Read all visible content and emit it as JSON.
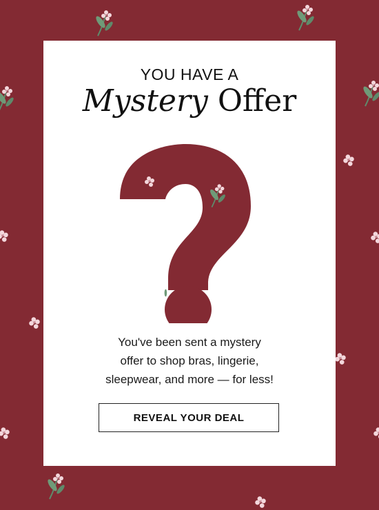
{
  "headline": {
    "line1": "YOU HAVE A",
    "italic_word": "Mystery",
    "regular_word": "Offer"
  },
  "graphic": {
    "icon": "question-mark-icon",
    "glyph": "?",
    "color": "#832a33"
  },
  "body": {
    "text": "You've been sent a mystery\noffer to shop bras, lingerie,\nsleepwear, and more — for less!"
  },
  "cta": {
    "label": "REVEAL YOUR DEAL"
  },
  "colors": {
    "background": "#832a33",
    "card": "#ffffff",
    "flower_petal": "#f3d7dc",
    "leaf": "#5f8a6b"
  }
}
